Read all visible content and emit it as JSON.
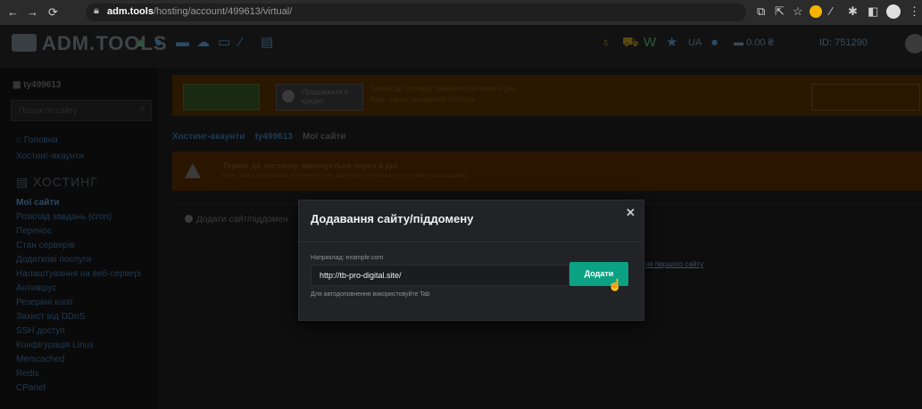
{
  "browser": {
    "url_host": "adm.tools",
    "url_path": "/hosting/account/499613/virtual/"
  },
  "header": {
    "logo_text": "ADM.TOOLS",
    "lang": "UA",
    "balance": "0.00 ₴",
    "account_id": "ID: 751290"
  },
  "sidebar": {
    "account": "ty499613",
    "search_placeholder": "Пошук по сайту",
    "home": "Головна",
    "hosting_accounts": "Хостинг-акаунти",
    "section": "ХОСТИНГ",
    "items": [
      "Мої сайти",
      "Розклад завдань (cron)",
      "Перенос",
      "Стан серверів",
      "Додаткові послуги",
      "Налаштування на веб-сервері",
      "Антивірус",
      "Резервні копії",
      "Захист від DDoS",
      "SSH доступ",
      "Конфігурація Linux",
      "Memcached",
      "Redis",
      "CPanel"
    ]
  },
  "banner": {
    "btn1": "Продовжити",
    "btn2": "Продовжити в кредит",
    "text1": "Термін дії хостингу закінчується через 4 дні",
    "text2": "Будь ласка, продовжте послуги"
  },
  "breadcrumbs": [
    "Хостинг-акаунти",
    "ty499613",
    "Мої сайти"
  ],
  "warning": {
    "title": "Термін дії хостингу закінчується через 4 дні",
    "text": "Будь ласка, продовжте хостинг-акаунт, щоб користуватись послугами в подальшому"
  },
  "main": {
    "add_site": "Додати сайт/піддомен",
    "first_site_link": "ня першого сайту"
  },
  "modal": {
    "title": "Додавання сайту/піддомену",
    "example_label": "Наприклад: example.com",
    "input_value": "http://tb-pro-digital.site/",
    "add_button": "Додати",
    "hint": "Для автодоповнення використовуйте Tab"
  }
}
